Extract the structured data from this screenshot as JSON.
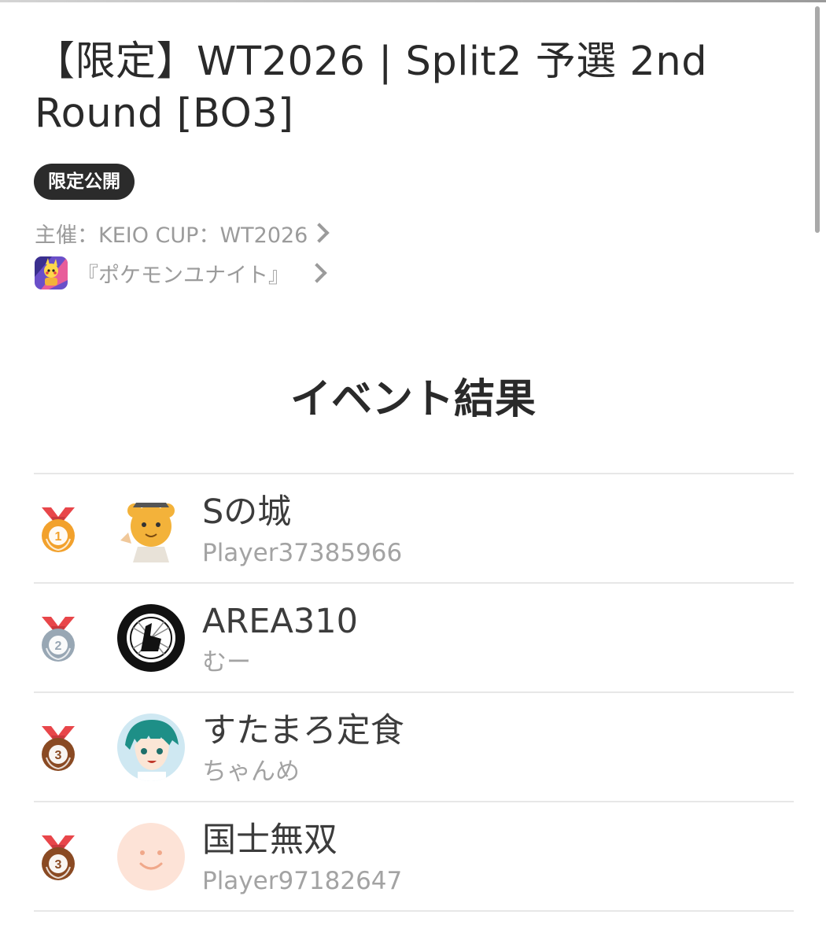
{
  "event": {
    "title": "【限定】WT2026 | Split2 予選 2nd Round [BO3]",
    "visibility_badge": "限定公開",
    "organizer": "主催：KEIO CUP：WT2026",
    "game": "『ポケモンユナイト』"
  },
  "results": {
    "heading": "イベント結果",
    "entries": [
      {
        "rank": "1",
        "medal_color": "#f2a12c",
        "team": "Sの城",
        "player": "Player37385966"
      },
      {
        "rank": "2",
        "medal_color": "#98a7b4",
        "team": "AREA310",
        "player": "むー"
      },
      {
        "rank": "3",
        "medal_color": "#8a4a23",
        "team": "すたまろ定食",
        "player": "ちゃんめ"
      },
      {
        "rank": "3",
        "medal_color": "#8a4a23",
        "team": "国士無双",
        "player": "Player97182647"
      }
    ]
  },
  "colors": {
    "ribbon": "#e8464a",
    "badge_bg": "#2b2b2b",
    "secondary_text": "#9b9b9b"
  },
  "icons": {
    "organizer_link": "chevron-right-icon",
    "game_link": "chevron-right-icon",
    "game": "pokemon-unite-game-icon",
    "avatars": [
      "character-avatar",
      "area310-logo-avatar",
      "character-avatar",
      "default-smiley-avatar"
    ]
  }
}
